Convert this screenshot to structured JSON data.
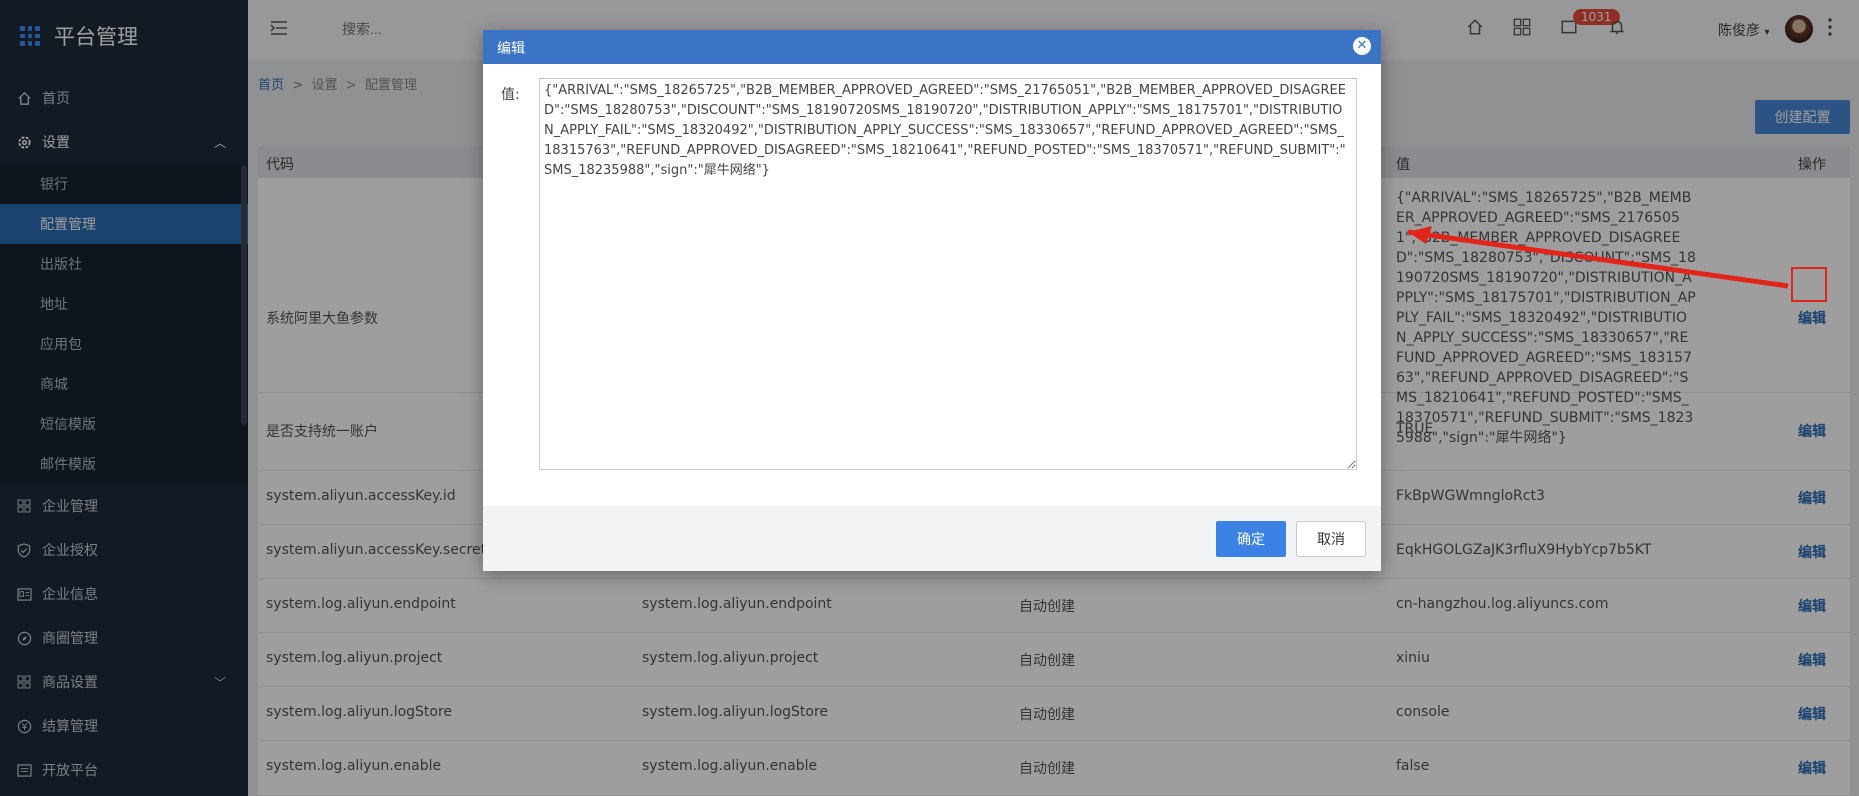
{
  "brand": {
    "title": "平台管理"
  },
  "sidebar": {
    "home": "首页",
    "settings": "设置",
    "sub": [
      "银行",
      "配置管理",
      "出版社",
      "地址",
      "应用包",
      "商城",
      "短信模版",
      "邮件模版"
    ],
    "items": [
      "企业管理",
      "企业授权",
      "企业信息",
      "商圈管理",
      "商品设置",
      "结算管理",
      "开放平台"
    ]
  },
  "topbar": {
    "search_placeholder": "搜索...",
    "badge": "1031",
    "user": "陈俊彦"
  },
  "breadcrumb": {
    "home": "首页",
    "sep": ">",
    "settings": "设置",
    "current": "配置管理"
  },
  "create_button": "创建配置",
  "table": {
    "headers": {
      "code": "代码",
      "value": "值",
      "ops": "操作"
    },
    "edit_label": "编辑",
    "rows": [
      {
        "code": "系统阿里大鱼参数",
        "name": "",
        "type": "",
        "value": "{\"ARRIVAL\":\"SMS_18265725\",\"B2B_MEMBER_APPROVED_AGREED\":\"SMS_21765051\",\"B2B_MEMBER_APPROVED_DISAGREED\":\"SMS_18280753\",\"DISCOUNT\":\"SMS_18190720SMS_18190720\",\"DISTRIBUTION_APPLY\":\"SMS_18175701\",\"DISTRIBUTION_APPLY_FAIL\":\"SMS_18320492\",\"DISTRIBUTION_APPLY_SUCCESS\":\"SMS_18330657\",\"REFUND_APPROVED_AGREED\":\"SMS_18315763\",\"REFUND_APPROVED_DISAGREED\":\"SMS_18210641\",\"REFUND_POSTED\":\"SMS_18370571\",\"REFUND_SUBMIT\":\"SMS_18235988\",\"sign\":\"犀牛网络\"}"
      },
      {
        "code": "是否支持统一账户",
        "name": "",
        "type": "",
        "value": "TRUE"
      },
      {
        "code": "system.aliyun.accessKey.id",
        "name": "",
        "type": "",
        "value": "FkBpWGWmngloRct3"
      },
      {
        "code": "system.aliyun.accessKey.secret",
        "name": "",
        "type": "",
        "value": "EqkHGOLGZaJK3rfluX9HybYcp7b5KT"
      },
      {
        "code": "system.log.aliyun.endpoint",
        "name": "system.log.aliyun.endpoint",
        "type": "自动创建",
        "value": "cn-hangzhou.log.aliyuncs.com"
      },
      {
        "code": "system.log.aliyun.project",
        "name": "system.log.aliyun.project",
        "type": "自动创建",
        "value": "xiniu"
      },
      {
        "code": "system.log.aliyun.logStore",
        "name": "system.log.aliyun.logStore",
        "type": "自动创建",
        "value": "console"
      },
      {
        "code": "system.log.aliyun.enable",
        "name": "system.log.aliyun.enable",
        "type": "自动创建",
        "value": "false"
      }
    ]
  },
  "modal": {
    "title": "编辑",
    "label": "值:",
    "value": "{\"ARRIVAL\":\"SMS_18265725\",\"B2B_MEMBER_APPROVED_AGREED\":\"SMS_21765051\",\"B2B_MEMBER_APPROVED_DISAGREED\":\"SMS_18280753\",\"DISCOUNT\":\"SMS_18190720SMS_18190720\",\"DISTRIBUTION_APPLY\":\"SMS_18175701\",\"DISTRIBUTION_APPLY_FAIL\":\"SMS_18320492\",\"DISTRIBUTION_APPLY_SUCCESS\":\"SMS_18330657\",\"REFUND_APPROVED_AGREED\":\"SMS_18315763\",\"REFUND_APPROVED_DISAGREED\":\"SMS_18210641\",\"REFUND_POSTED\":\"SMS_18370571\",\"REFUND_SUBMIT\":\"SMS_18235988\",\"sign\":\"犀牛网络\"}",
    "ok": "确定",
    "cancel": "取消"
  }
}
